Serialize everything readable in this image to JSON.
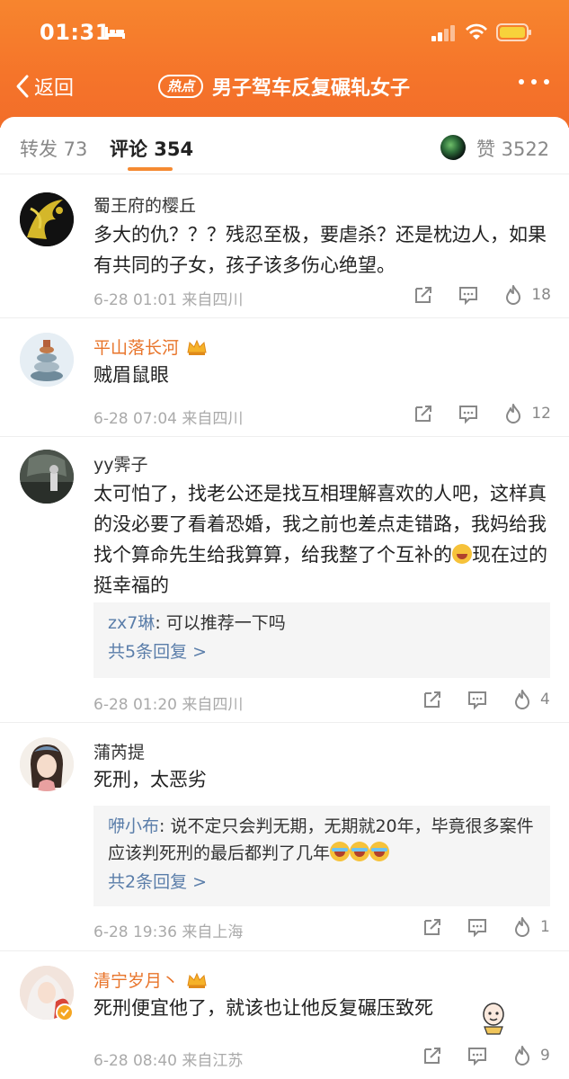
{
  "status_bar": {
    "time": "01:31"
  },
  "nav": {
    "back_label": "返回",
    "hot_badge": "热点",
    "title": "男子驾车反复碾轧女子"
  },
  "tabs": {
    "repost": "转发 73",
    "comment": "评论 354",
    "like": "赞 3522"
  },
  "comments": [
    {
      "user": "蜀王府的樱丘",
      "vip": false,
      "text": "多大的仇？？？残忍至极，要虐杀？还是枕边人，如果有共同的子女，孩子该多伤心绝望。",
      "meta": "6-28 01:01  来自四川",
      "likes": "18"
    },
    {
      "user": "平山落长河",
      "vip": true,
      "text": "贼眉鼠眼",
      "meta": "6-28 07:04  来自四川",
      "likes": "12"
    },
    {
      "user": "yy霁子",
      "vip": false,
      "text": "太可怕了，找老公还是找互相理解喜欢的人吧，这样真的没必要了看着恐婚，我之前也差点走错路，我妈给我找个算命先生给我算算，给我整了个互补的",
      "text_after_emoji": "现在过的挺幸福的",
      "reply_user": "zx7琳",
      "reply_text": ": 可以推荐一下吗",
      "reply_more": "共5条回复 >",
      "meta": "6-28 01:20  来自四川",
      "likes": "4"
    },
    {
      "user": "蒲芮提",
      "vip": false,
      "text": "死刑，太恶劣",
      "reply_user": "咿小布",
      "reply_text": ": 说不定只会判无期，无期就20年，毕竟很多案件应该判死刑的最后都判了几年",
      "reply_more": "共2条回复 >",
      "meta": "6-28 19:36  来自上海",
      "likes": "1"
    },
    {
      "user": "清宁岁月丶",
      "vip": true,
      "text": "死刑便宜他了，就该也让他反复碾压致死",
      "meta": "6-28 08:40  来自江苏",
      "likes": "9"
    }
  ],
  "colors": {
    "header": "#f5742a",
    "accent": "#f58a32",
    "reply_link": "#5b7eaa"
  }
}
